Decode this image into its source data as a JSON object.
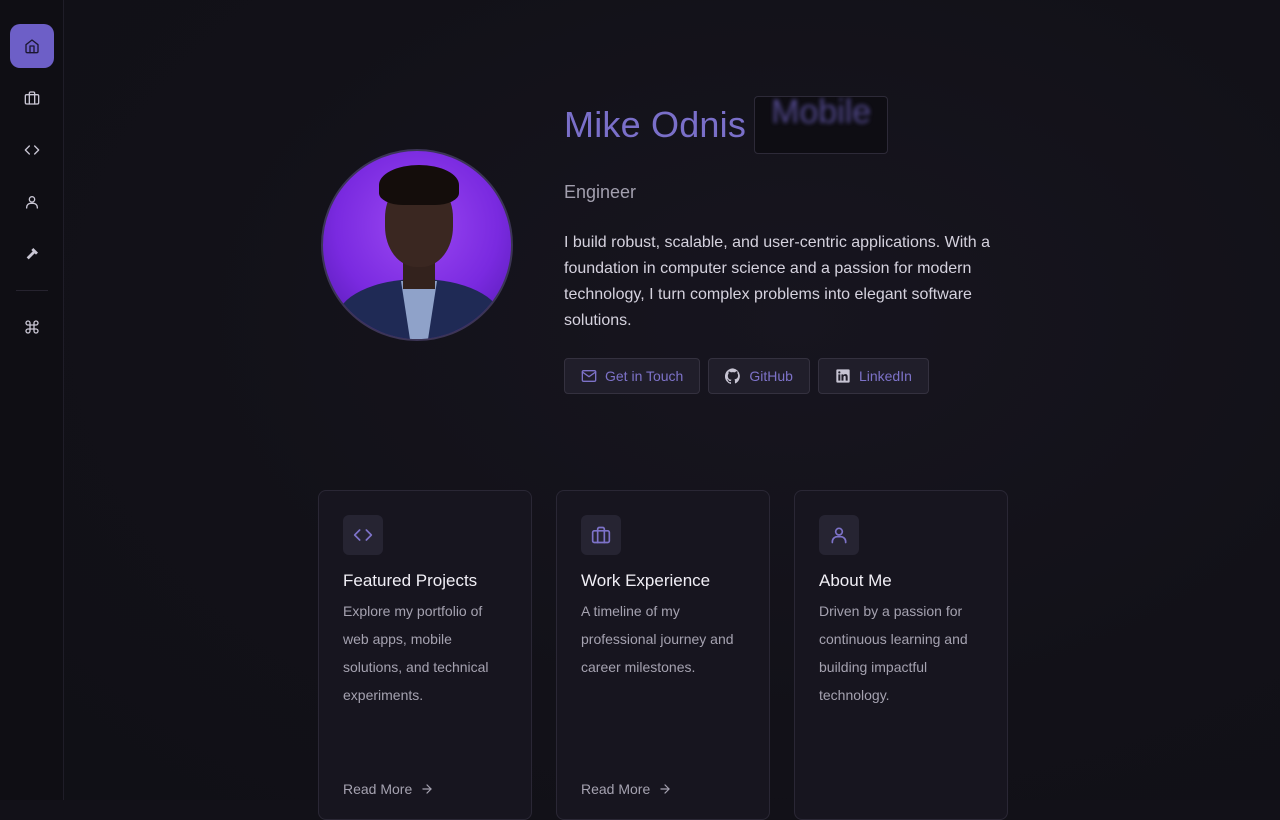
{
  "sidebar": {
    "items": [
      {
        "icon": "home-icon",
        "active": true
      },
      {
        "icon": "briefcase-icon",
        "active": false
      },
      {
        "icon": "code-icon",
        "active": false
      },
      {
        "icon": "user-icon",
        "active": false
      },
      {
        "icon": "hammer-icon",
        "active": false
      },
      {
        "icon": "command-icon",
        "active": false
      }
    ]
  },
  "hero": {
    "name": "Mike Odnis",
    "role_word": "Mobile",
    "subtitle": "Engineer",
    "bio": "I build robust, scalable, and user-centric applications. With a foundation in computer science and a passion for modern technology, I turn complex problems into elegant software solutions.",
    "buttons": {
      "contact": "Get in Touch",
      "github": "GitHub",
      "linkedin": "LinkedIn"
    }
  },
  "cards": [
    {
      "icon": "code-icon",
      "title": "Featured Projects",
      "description": "Explore my portfolio of web apps, mobile solutions, and technical experiments.",
      "link": "Read More"
    },
    {
      "icon": "briefcase-icon",
      "title": "Work Experience",
      "description": "A timeline of my professional journey and career milestones.",
      "link": "Read More"
    },
    {
      "icon": "user-icon",
      "title": "About Me",
      "description": "Driven by a passion for continuous learning and building impactful technology.",
      "link": ""
    }
  ],
  "colors": {
    "accent": "#7a6fc9",
    "active_nav": "#6d5fc7",
    "background": "#121118"
  }
}
